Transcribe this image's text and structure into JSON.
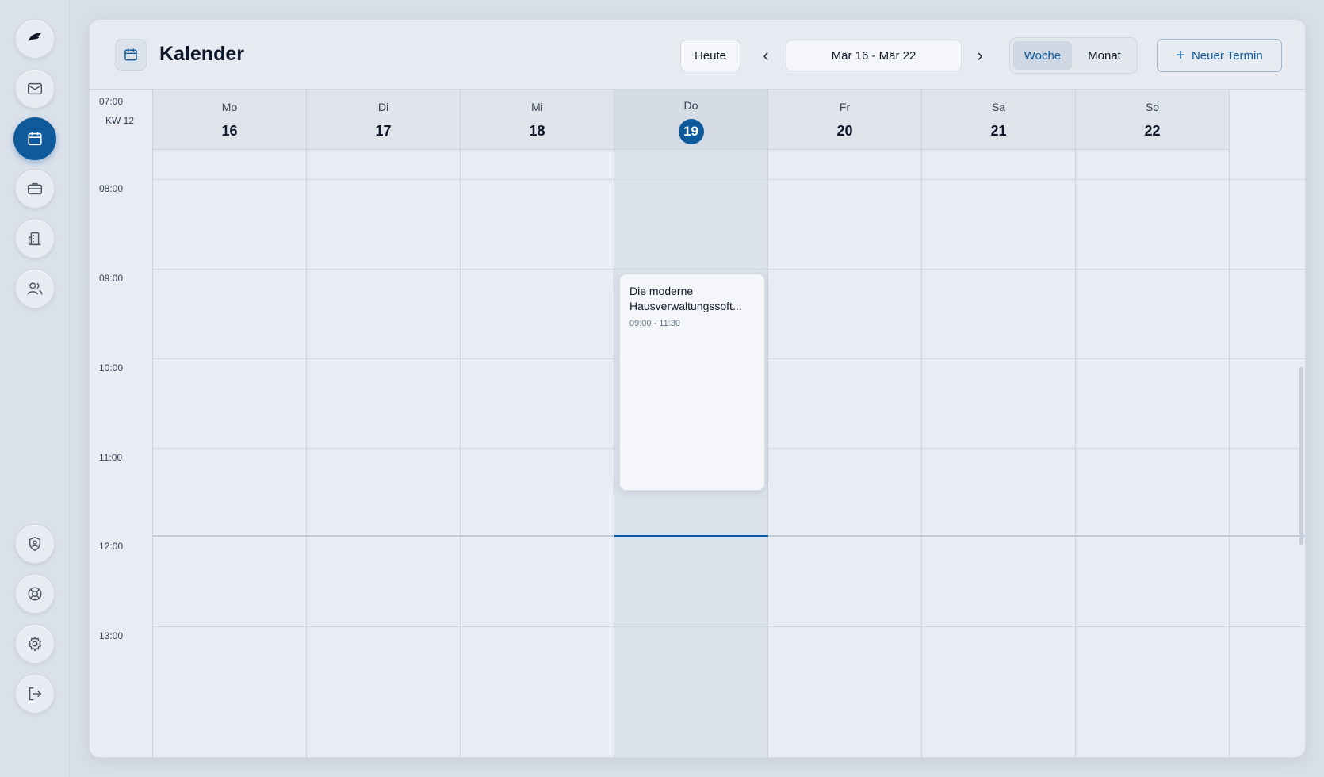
{
  "header": {
    "title": "Kalender",
    "today_label": "Heute",
    "prev_label": "‹",
    "next_label": "›",
    "date_range": "Mär 16 - Mär 22",
    "view_week": "Woche",
    "view_month": "Monat",
    "new_event_label": "Neuer Termin",
    "new_event_plus": "+"
  },
  "sidebar": {
    "items": [
      {
        "icon": "logo-leaf-icon"
      },
      {
        "icon": "mail-icon"
      },
      {
        "icon": "calendar-icon",
        "active": true
      },
      {
        "icon": "briefcase-icon"
      },
      {
        "icon": "building-icon"
      },
      {
        "icon": "users-icon"
      }
    ],
    "bottom_items": [
      {
        "icon": "shield-user-icon"
      },
      {
        "icon": "lifebuoy-icon"
      },
      {
        "icon": "gear-icon"
      },
      {
        "icon": "logout-icon"
      }
    ]
  },
  "calendar": {
    "first_time": "07:00",
    "week_label": "KW 12",
    "days": [
      {
        "name": "Mo",
        "num": "16"
      },
      {
        "name": "Di",
        "num": "17"
      },
      {
        "name": "Mi",
        "num": "18"
      },
      {
        "name": "Do",
        "num": "19",
        "today": true
      },
      {
        "name": "Fr",
        "num": "20"
      },
      {
        "name": "Sa",
        "num": "21"
      },
      {
        "name": "So",
        "num": "22"
      }
    ],
    "times": [
      "08:00",
      "09:00",
      "10:00",
      "11:00",
      "12:00",
      "13:00"
    ],
    "events": [
      {
        "title": "Die moderne Hausverwaltungssoft...",
        "time": "09:00 - 11:30",
        "day": "Do"
      }
    ]
  },
  "colors": {
    "accent": "#0e5a9a",
    "background": "#e9edf3"
  }
}
